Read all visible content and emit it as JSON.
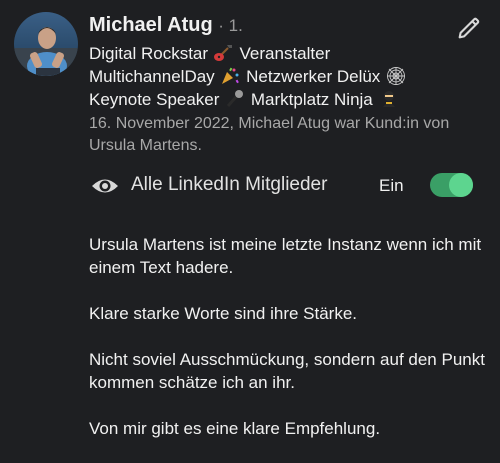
{
  "recommendation": {
    "author": {
      "name": "Michael Atug",
      "degree": "· 1.",
      "headline_lines": [
        "Digital Rockstar",
        "Veranstalter",
        "MultichannelDay",
        "Netzwerker Delüx",
        "Keynote Speaker",
        "Marktplatz Ninja"
      ],
      "emoji_icons": [
        "guitar-emoji",
        "confetti-emoji",
        "spiderweb-emoji",
        "microphone-emoji",
        "ninja-emoji"
      ]
    },
    "meta_text": "16. November 2022, Michael Atug war Kund:in von Ursula Martens.",
    "visibility": {
      "label": "Alle LinkedIn Mitglieder",
      "toggle_label": "Ein",
      "toggle_on": true
    },
    "message_paragraphs": [
      "Ursula Martens ist meine letzte Instanz wenn ich mit einem Text hadere.",
      "Klare starke Worte sind ihre Stärke.",
      "Nicht soviel Ausschmückung, sondern auf den Punkt kommen schätze ich an ihr.",
      "Von mir gibt es eine klare Empfehlung."
    ]
  },
  "colors": {
    "background": "#1e1f22",
    "text": "#f1f1f1",
    "muted": "#a8a8a8",
    "toggle_track": "#3a9f66",
    "toggle_knob": "#5dd58f"
  }
}
